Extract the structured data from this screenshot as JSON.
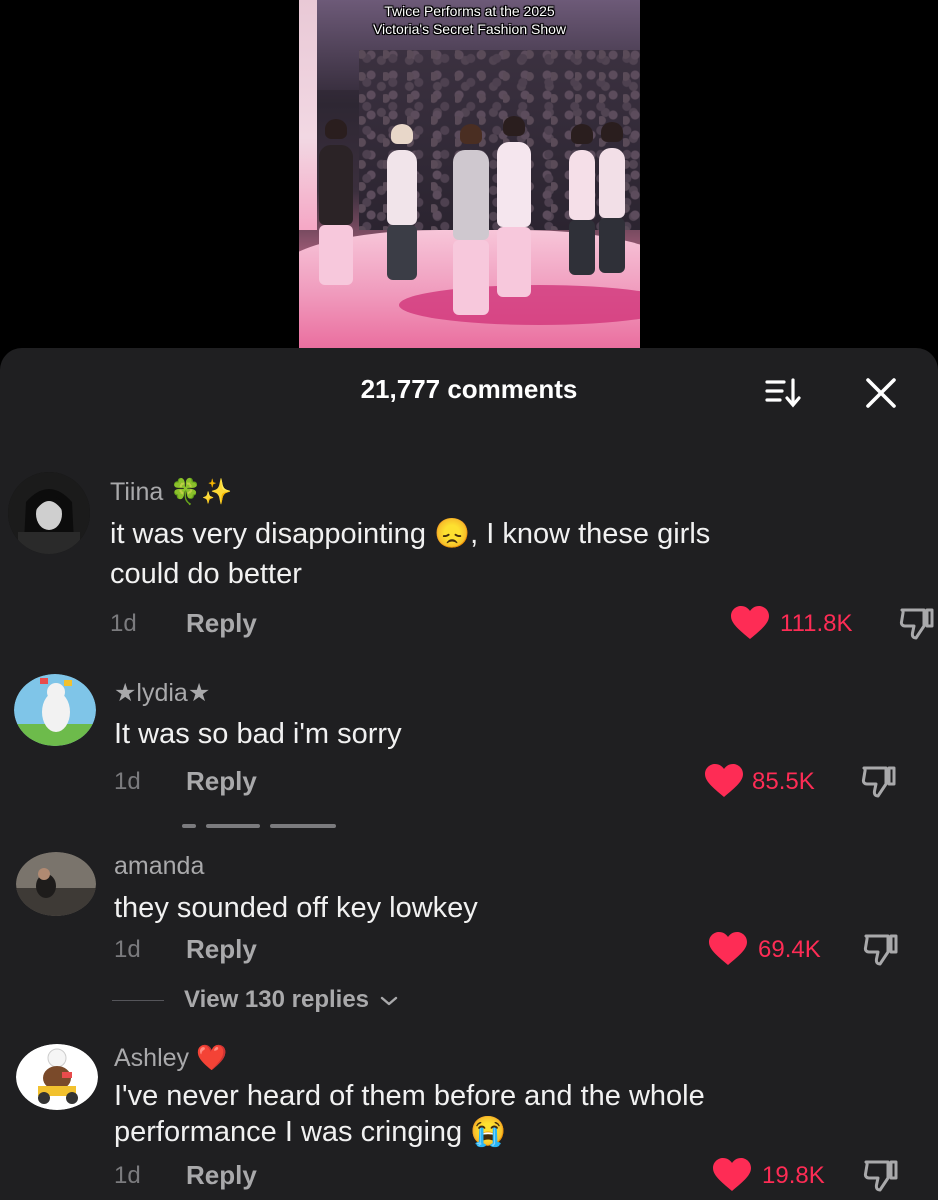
{
  "video": {
    "title_line1": "Twice Performs at the 2025",
    "title_line2": "Victoria's Secret Fashion Show"
  },
  "comments_header": {
    "count_label": "21,777 comments"
  },
  "colors": {
    "like_red": "#fe2c55",
    "sheet_bg": "#1f1f21"
  },
  "comments": [
    {
      "username": "Tiina 🍀✨",
      "text_line1": "it was very disappointing 😞, I know these girls",
      "text_line2": "could do better",
      "time": "1d",
      "reply_label": "Reply",
      "likes": "111.8K"
    },
    {
      "username": "★lydia★",
      "text_line1": "It was so bad i'm sorry",
      "time": "1d",
      "reply_label": "Reply",
      "likes": "85.5K"
    },
    {
      "username": "amanda",
      "text_line1": "they sounded off key lowkey",
      "time": "1d",
      "reply_label": "Reply",
      "likes": "69.4K",
      "view_replies": "View 130 replies"
    },
    {
      "username": "Ashley ❤️",
      "text_line1": "I've never heard of them before and the whole",
      "text_line2": "performance I was cringing 😭",
      "time": "1d",
      "reply_label": "Reply",
      "likes": "19.8K"
    }
  ],
  "icons": {
    "sort": "sort-icon",
    "close": "close-icon",
    "heart": "heart-icon",
    "dislike": "dislike-icon"
  }
}
